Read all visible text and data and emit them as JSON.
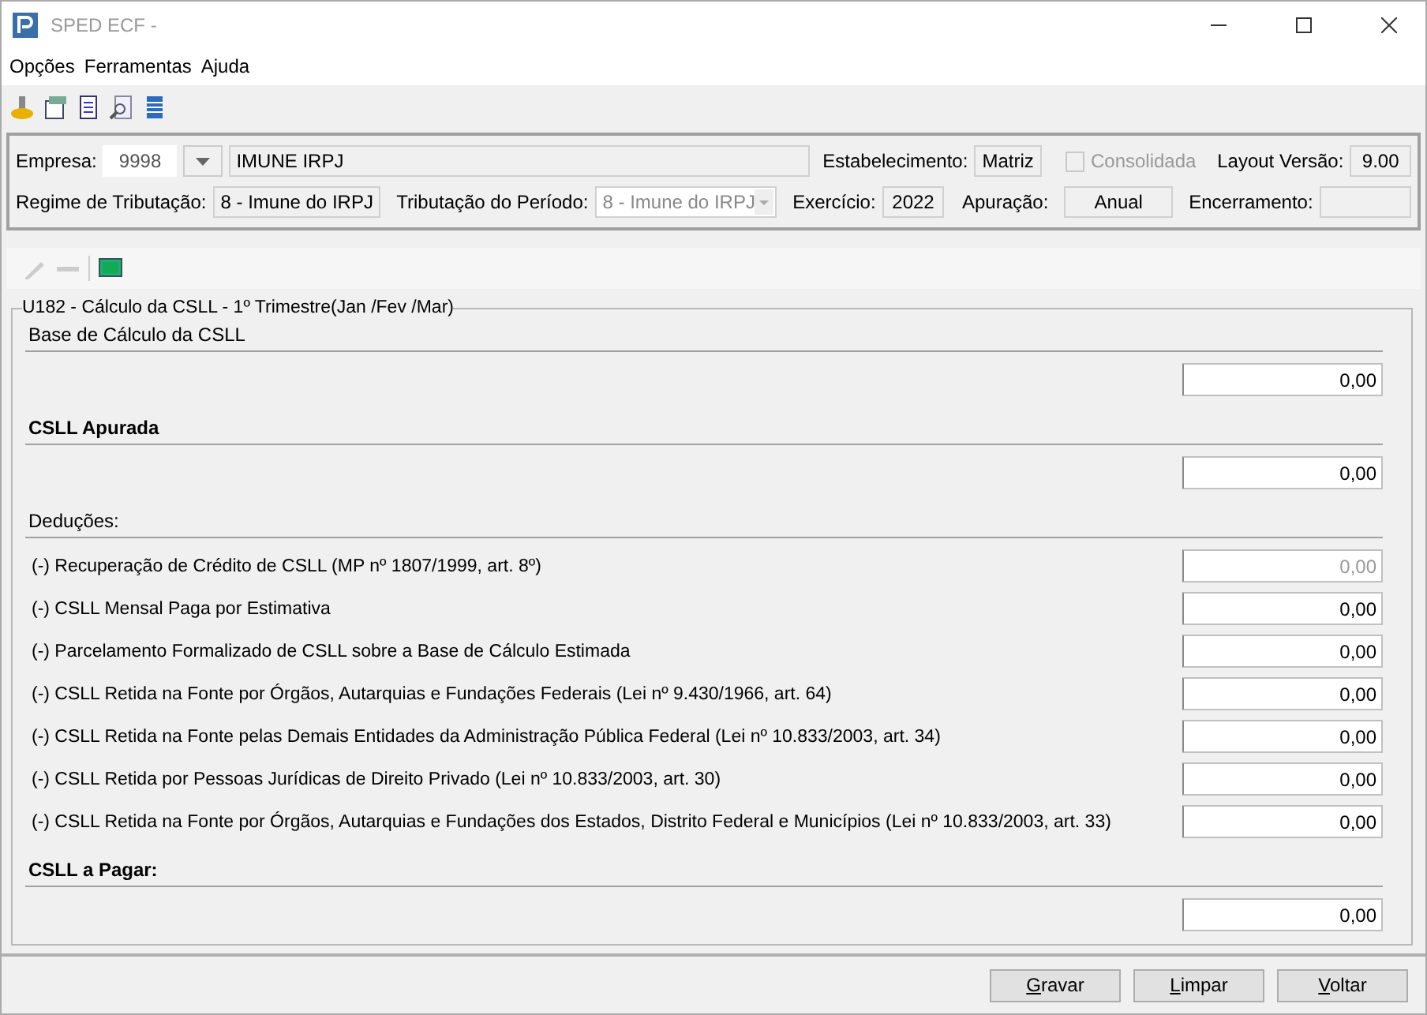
{
  "window": {
    "title": "SPED ECF -"
  },
  "menu": [
    "Opções",
    "Ferramentas",
    "Ajuda"
  ],
  "header": {
    "empresa_label": "Empresa:",
    "empresa_code": "9998",
    "empresa_name": "IMUNE IRPJ",
    "estabelecimento_label": "Estabelecimento:",
    "estabelecimento": "Matriz",
    "consolidada": {
      "label": "Consolidada",
      "checked": false,
      "disabled": true
    },
    "layout_label": "Layout Versão:",
    "layout": "9.00",
    "regime_label": "Regime de Tributação:",
    "regime": "8 - Imune do IRPJ",
    "tributacao_label": "Tributação do Período:",
    "tributacao": "8 - Imune do IRPJ",
    "exercicio_label": "Exercício:",
    "exercicio": "2022",
    "apuracao_label": "Apuração:",
    "apuracao": "Anual",
    "encerramento_label": "Encerramento:"
  },
  "form": {
    "title": "U182 - Cálculo da CSLL - 1º Trimestre(Jan /Fev /Mar)",
    "sections": [
      {
        "heading": "Base de Cálculo da CSLL",
        "bold": false,
        "rows": [
          {
            "value": "0,00",
            "disabled": false
          }
        ]
      },
      {
        "heading": "CSLL Apurada",
        "bold": true,
        "rows": [
          {
            "value": "0,00",
            "disabled": false
          }
        ]
      },
      {
        "heading": "Deduções:",
        "bold": false,
        "rows": [
          {
            "label": "(-) Recuperação de Crédito de CSLL (MP nº 1807/1999, art. 8º)",
            "value": "0,00",
            "disabled": true
          },
          {
            "label": "(-) CSLL Mensal Paga por Estimativa",
            "value": "0,00",
            "disabled": false
          },
          {
            "label": "(-) Parcelamento Formalizado de CSLL sobre a Base de Cálculo Estimada",
            "value": "0,00",
            "disabled": false
          },
          {
            "label": "(-) CSLL Retida na Fonte por Órgãos, Autarquias e Fundações Federais (Lei nº 9.430/1966, art. 64)",
            "value": "0,00",
            "disabled": false
          },
          {
            "label": "(-) CSLL Retida na Fonte pelas Demais Entidades da Administração Pública Federal (Lei nº 10.833/2003, art. 34)",
            "value": "0,00",
            "disabled": false
          },
          {
            "label": "(-) CSLL Retida por Pessoas Jurídicas de Direito Privado (Lei nº 10.833/2003, art. 30)",
            "value": "0,00",
            "disabled": false
          },
          {
            "label": "(-) CSLL Retida na Fonte por Órgãos, Autarquias e Fundações dos Estados, Distrito Federal e Municípios (Lei nº 10.833/2003, art. 33)",
            "value": "0,00",
            "disabled": false
          }
        ]
      },
      {
        "heading": "CSLL a Pagar:",
        "bold": true,
        "rows": [
          {
            "value": "0,00",
            "disabled": false
          }
        ]
      }
    ]
  },
  "buttons": [
    "Gravar",
    "Limpar",
    "Voltar"
  ]
}
